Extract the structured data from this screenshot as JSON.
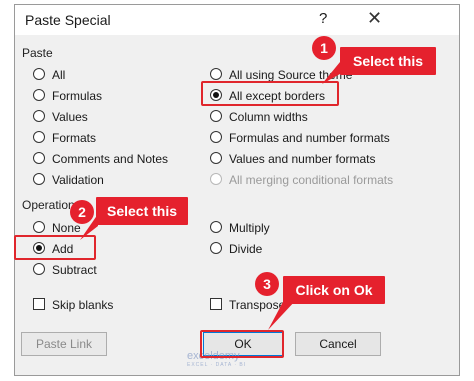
{
  "dialog": {
    "title": "Paste Special",
    "help": "?",
    "close": "✕"
  },
  "paste": {
    "label": "Paste",
    "left": [
      {
        "label": "All",
        "selected": false
      },
      {
        "label": "Formulas",
        "selected": false
      },
      {
        "label": "Values",
        "selected": false
      },
      {
        "label": "Formats",
        "selected": false
      },
      {
        "label": "Comments and Notes",
        "selected": false
      },
      {
        "label": "Validation",
        "selected": false
      }
    ],
    "right": [
      {
        "label": "All using Source theme",
        "selected": false,
        "disabled": false
      },
      {
        "label": "All except borders",
        "selected": true,
        "disabled": false
      },
      {
        "label": "Column widths",
        "selected": false,
        "disabled": false
      },
      {
        "label": "Formulas and number formats",
        "selected": false,
        "disabled": false
      },
      {
        "label": "Values and number formats",
        "selected": false,
        "disabled": false
      },
      {
        "label": "All merging conditional formats",
        "selected": false,
        "disabled": true
      }
    ]
  },
  "operation": {
    "label": "Operation",
    "left": [
      {
        "label": "None",
        "selected": false
      },
      {
        "label": "Add",
        "selected": true
      },
      {
        "label": "Subtract",
        "selected": false
      }
    ],
    "right": [
      {
        "label": "Multiply",
        "selected": false
      },
      {
        "label": "Divide",
        "selected": false
      }
    ]
  },
  "checkboxes": {
    "skip_blanks": "Skip blanks",
    "transpose": "Transpose"
  },
  "buttons": {
    "paste_link": "Paste Link",
    "ok": "OK",
    "cancel": "Cancel"
  },
  "annotations": {
    "callout1": "Select this",
    "callout2": "Select this",
    "callout3": "Click on Ok",
    "badge1": "1",
    "badge2": "2",
    "badge3": "3",
    "accent": "#e5212d"
  },
  "watermark": {
    "name": "exceldemy",
    "tagline": "EXCEL · DATA · BI"
  }
}
